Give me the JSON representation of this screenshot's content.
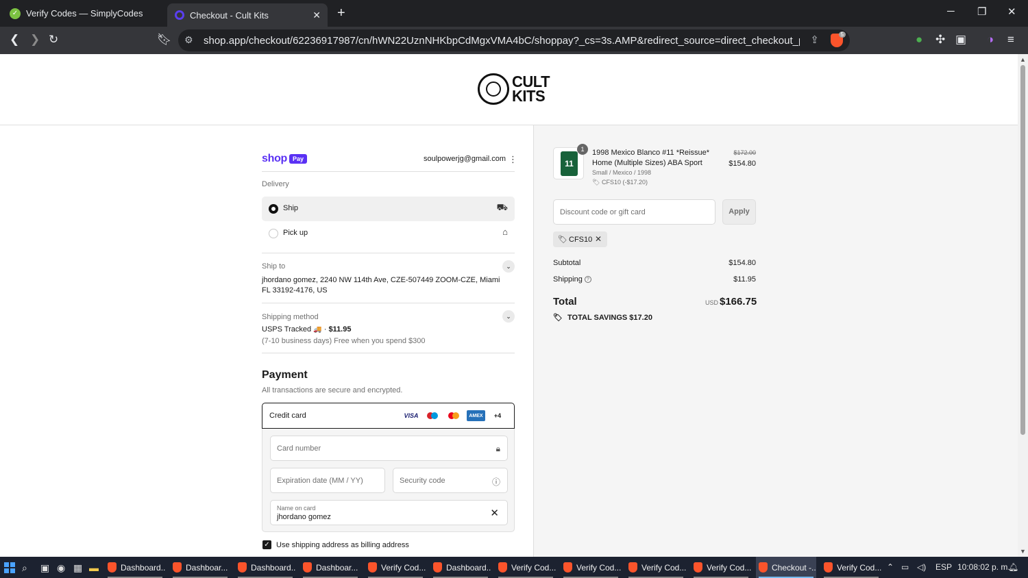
{
  "browser": {
    "tabs": [
      {
        "title": "Verify Codes — SimplyCodes",
        "active": false
      },
      {
        "title": "Checkout - Cult Kits",
        "active": true
      }
    ],
    "url": "shop.app/checkout/62236917987/cn/hWN22UznNHKbpCdMgxVMA4bC/shoppay?_cs=3s.AMP&redirect_source=direct_checkout_product&tr...",
    "shield_count": "5"
  },
  "store": {
    "logo_text_line1": "CULT",
    "logo_text_line2": "KITS"
  },
  "shoppay": {
    "shop": "shop",
    "pay": "Pay",
    "email": "soulpowerjg@gmail.com"
  },
  "delivery": {
    "label": "Delivery",
    "options": [
      {
        "label": "Ship",
        "selected": true,
        "icon": "truck-icon"
      },
      {
        "label": "Pick up",
        "selected": false,
        "icon": "store-icon"
      }
    ]
  },
  "ship_to": {
    "label": "Ship to",
    "address": "jhordano gomez, 2240 NW 114th Ave, CZE-507449 ZOOM-CZE, Miami FL 33192-4176, US"
  },
  "shipping_method": {
    "label": "Shipping method",
    "name": "USPS Tracked",
    "emoji": "🚚",
    "price": "$11.95",
    "note": "(7-10 business days) Free when you spend $300"
  },
  "payment": {
    "title": "Payment",
    "subtitle": "All transactions are secure and encrypted.",
    "method": "Credit card",
    "card_brands": [
      "VISA",
      "maestro",
      "mastercard",
      "AMEX"
    ],
    "more_brands": "+4",
    "card_number_placeholder": "Card number",
    "expiry_placeholder": "Expiration date (MM / YY)",
    "security_placeholder": "Security code",
    "name_label": "Name on card",
    "name_value": "jhordano gomez",
    "billing_same_label": "Use shipping address as billing address",
    "billing_same_checked": true
  },
  "order": {
    "product": {
      "quantity": "1",
      "name": "1998 Mexico Blanco #11 *Reissue* Home (Multiple Sizes) ABA Sport",
      "variant": "Small / Mexico / 1998",
      "discount": "CFS10 (-$17.20)",
      "original_price": "$172.00",
      "price": "$154.80",
      "jersey_number": "11"
    },
    "discount_placeholder": "Discount code or gift card",
    "apply_label": "Apply",
    "applied_code": "CFS10",
    "subtotal_label": "Subtotal",
    "subtotal": "$154.80",
    "shipping_label": "Shipping",
    "shipping": "$11.95",
    "total_label": "Total",
    "currency": "USD",
    "total": "$166.75",
    "savings_label": "TOTAL SAVINGS",
    "savings": "$17.20"
  },
  "taskbar": {
    "apps": [
      {
        "label": "Dashboard...",
        "active": false
      },
      {
        "label": "Dashboar...",
        "active": false
      },
      {
        "label": "Dashboard...",
        "active": false
      },
      {
        "label": "Dashboar...",
        "active": false
      },
      {
        "label": "Verify Cod...",
        "active": false
      },
      {
        "label": "Dashboard...",
        "active": false
      },
      {
        "label": "Verify Cod...",
        "active": false
      },
      {
        "label": "Verify Cod...",
        "active": false
      },
      {
        "label": "Verify Cod...",
        "active": false
      },
      {
        "label": "Verify Cod...",
        "active": false
      },
      {
        "label": "Checkout -...",
        "active": true
      },
      {
        "label": "Verify Cod...",
        "active": false
      }
    ],
    "language": "ESP",
    "time": "10:08:02 p. m."
  }
}
